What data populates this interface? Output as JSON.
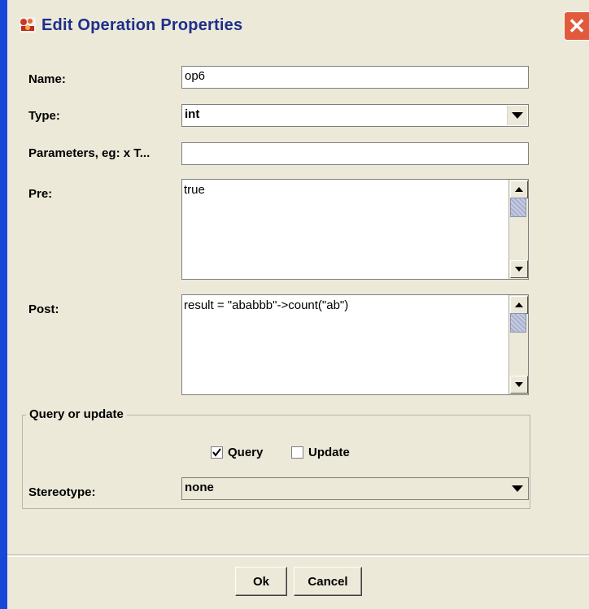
{
  "window": {
    "title": "Edit Operation Properties",
    "title_icon": "app-icon",
    "close_icon": "close-icon"
  },
  "form": {
    "name_label": "Name:",
    "name_value": "op6",
    "type_label": "Type:",
    "type_value": "int",
    "params_label": "Parameters, eg: x T...",
    "params_value": "",
    "pre_label": "Pre:",
    "pre_value": "true",
    "post_label": "Post:",
    "post_value": "result = \"ababbb\"->count(\"ab\")",
    "group_title": "Query or update",
    "query_label": "Query",
    "query_checked": true,
    "update_label": "Update",
    "update_checked": false,
    "stereotype_label": "Stereotype:",
    "stereotype_value": "none"
  },
  "buttons": {
    "ok": "Ok",
    "cancel": "Cancel"
  },
  "colors": {
    "title_text": "#1d2f8c",
    "close_button": "#e25a3c",
    "dialog_bg": "#ece9d8",
    "left_edge": "#1747d6"
  }
}
